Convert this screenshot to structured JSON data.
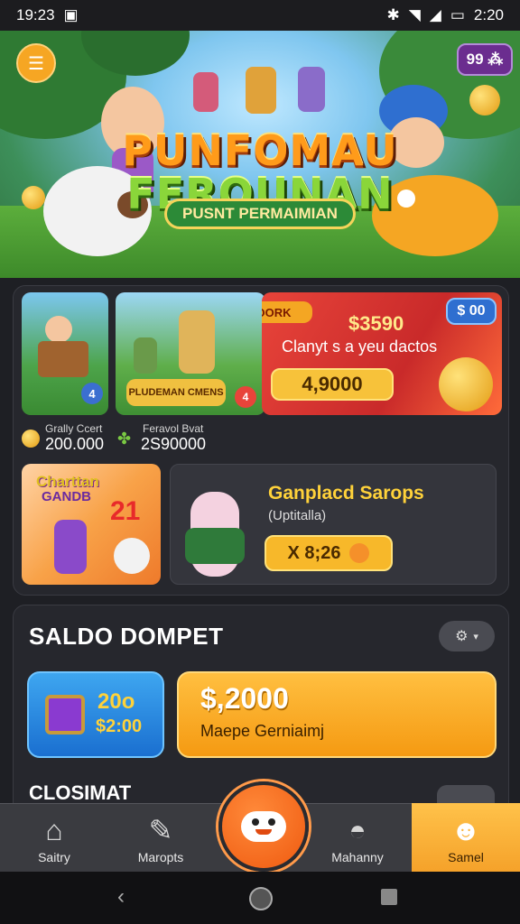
{
  "status_bar": {
    "time": "19:23",
    "right_text": "2:20"
  },
  "hero": {
    "title_line1": "PUNFOMAU",
    "title_line2": "FERQUNAN",
    "subtitle_button": "PUSNT PERMAIMIAN",
    "top_badge": "99 ⁂"
  },
  "games": {
    "tile1": {
      "label": "Grally Ccert",
      "value": "200.000",
      "badge": "4"
    },
    "tile2": {
      "label": "Feravol Bvat",
      "value": "2S90000",
      "overlay": "PLUDEMAN CMENS"
    },
    "promo": {
      "tag": "GOORK",
      "amount": "$3590",
      "desc": "Clanyt s a yeu dactos",
      "value_pill": "4,9000",
      "corner": "$ 00"
    },
    "tile4": {
      "line1": "Charttan",
      "line2": "GANDB",
      "number": "21"
    },
    "feature": {
      "title": "Ganplacd Sarops",
      "sub": "(Uptitalla)",
      "pill": "X 8;26"
    }
  },
  "wallet": {
    "title": "SALDO DOMPET",
    "left_top": "20o",
    "left_bottom": "$2:00",
    "right_amount": "$,2000",
    "right_desc": "Maepe Gerniaimj"
  },
  "section2_title": "CLOSIMAT",
  "nav": {
    "items": [
      {
        "label": "Saitry",
        "icon": "home-icon"
      },
      {
        "label": "Maropts",
        "icon": "map-icon"
      },
      {
        "label": "Mahanny",
        "icon": "helmet-icon"
      },
      {
        "label": "Samel",
        "icon": "profile-icon"
      }
    ]
  },
  "colors": {
    "accent_orange": "#f5a22a",
    "fab": "#ef5a10",
    "wallet_blue": "#1a6fd0"
  }
}
